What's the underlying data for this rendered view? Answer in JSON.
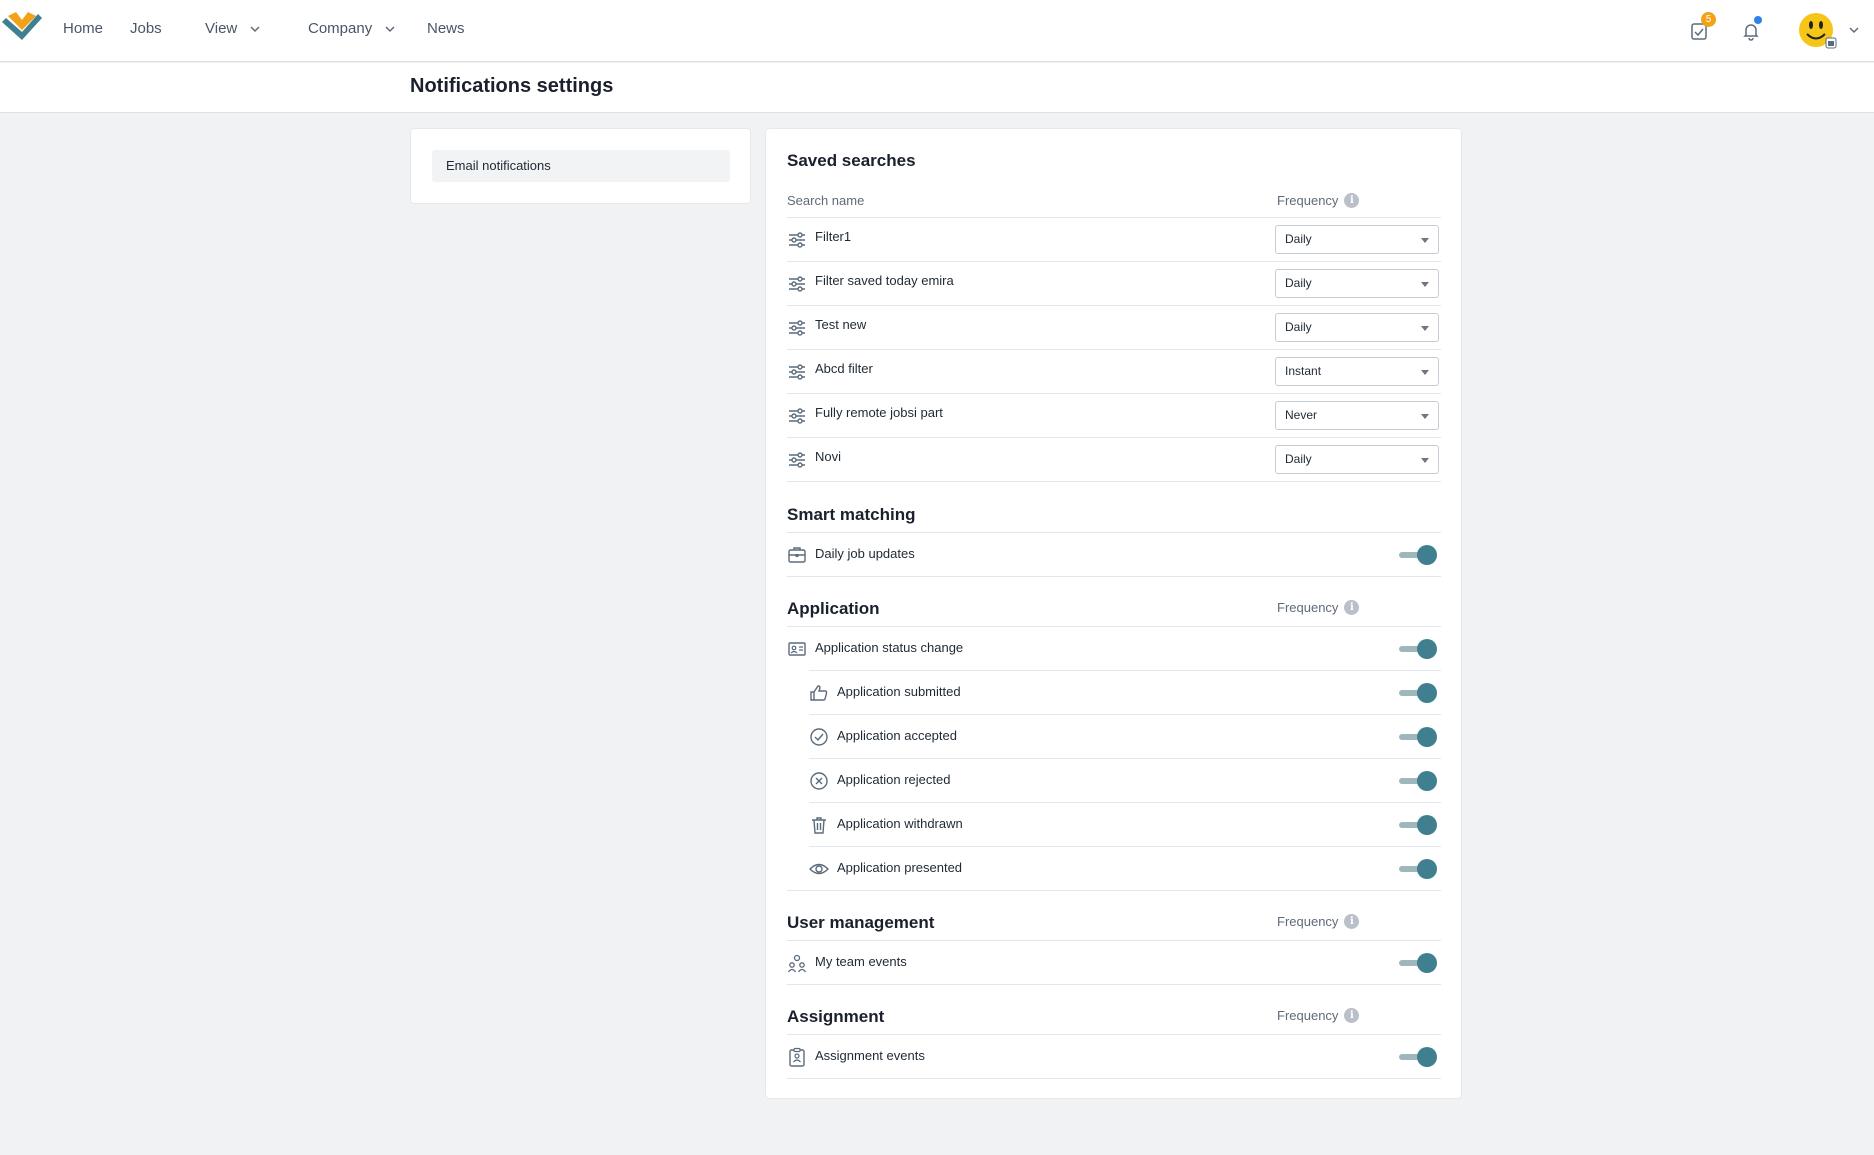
{
  "nav": {
    "home": "Home",
    "jobs": "Jobs",
    "view": "View",
    "company": "Company",
    "news": "News"
  },
  "header_icons": {
    "tasks_badge": "5",
    "brand_colors": {
      "orange": "#f2a218",
      "teal": "#3f7f8f"
    }
  },
  "page": {
    "title": "Notifications settings"
  },
  "sidebar": {
    "items": [
      {
        "label": "Email notifications"
      }
    ]
  },
  "saved_searches": {
    "title": "Saved searches",
    "col_name": "Search name",
    "col_frequency": "Frequency",
    "rows": [
      {
        "name": "Filter1",
        "frequency": "Daily"
      },
      {
        "name": "Filter saved today emira",
        "frequency": "Daily"
      },
      {
        "name": "Test new",
        "frequency": "Daily"
      },
      {
        "name": "Abcd filter",
        "frequency": "Instant"
      },
      {
        "name": "Fully remote jobsi part",
        "frequency": "Never"
      },
      {
        "name": "Novi",
        "frequency": "Daily"
      }
    ]
  },
  "smart_matching": {
    "title": "Smart matching",
    "rows": [
      {
        "label": "Daily job updates",
        "enabled": true
      }
    ]
  },
  "application": {
    "title": "Application",
    "col_frequency": "Frequency",
    "rows": [
      {
        "label": "Application status change",
        "enabled": true
      },
      {
        "label": "Application submitted",
        "enabled": true
      },
      {
        "label": "Application accepted",
        "enabled": true
      },
      {
        "label": "Application rejected",
        "enabled": true
      },
      {
        "label": "Application withdrawn",
        "enabled": true
      },
      {
        "label": "Application presented",
        "enabled": true
      }
    ]
  },
  "user_management": {
    "title": "User management",
    "col_frequency": "Frequency",
    "rows": [
      {
        "label": "My team events",
        "enabled": true
      }
    ]
  },
  "assignment": {
    "title": "Assignment",
    "col_frequency": "Frequency",
    "rows": [
      {
        "label": "Assignment events",
        "enabled": true
      }
    ]
  }
}
